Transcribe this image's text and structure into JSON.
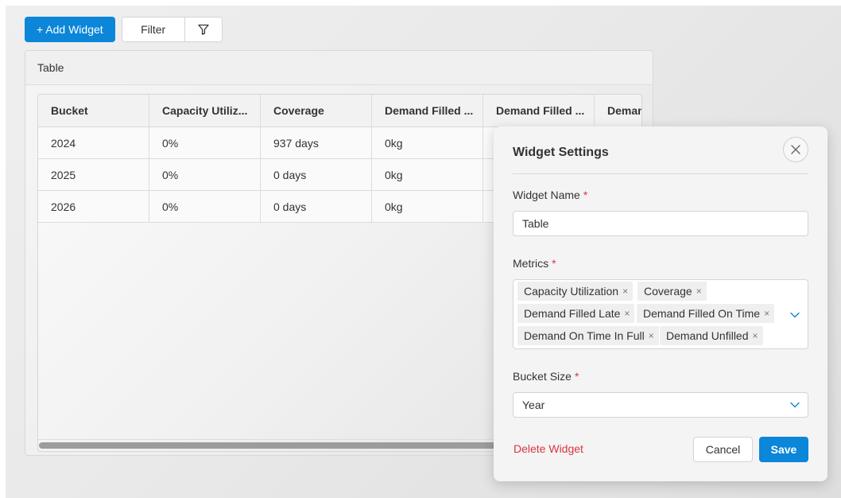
{
  "toolbar": {
    "add_widget_label": "+ Add Widget",
    "filter_label": "Filter",
    "filter_icon": "funnel-icon"
  },
  "widget": {
    "title": "Table",
    "table": {
      "columns": [
        "Bucket",
        "Capacity Utiliz...",
        "Coverage",
        "Demand Filled ...",
        "Demand Filled ...",
        "Deman"
      ],
      "rows": [
        [
          "2024",
          "0%",
          "937 days",
          "0kg"
        ],
        [
          "2025",
          "0%",
          "0 days",
          "0kg"
        ],
        [
          "2026",
          "0%",
          "0 days",
          "0kg"
        ]
      ]
    }
  },
  "modal": {
    "title": "Widget Settings",
    "close_icon": "close-icon",
    "widget_name": {
      "label": "Widget Name",
      "required_mark": "*",
      "value": "Table"
    },
    "metrics": {
      "label": "Metrics",
      "required_mark": "*",
      "selected": [
        "Capacity Utilization",
        "Coverage",
        "Demand Filled Late",
        "Demand Filled On Time",
        "Demand On Time In Full",
        "Demand Unfilled"
      ],
      "remove_glyph": "×"
    },
    "bucket_size": {
      "label": "Bucket Size",
      "required_mark": "*",
      "value": "Year"
    },
    "delete_label": "Delete Widget",
    "cancel_label": "Cancel",
    "save_label": "Save"
  },
  "colors": {
    "primary": "#0b86d8",
    "danger": "#d9363e",
    "chevron": "#0b86d8"
  }
}
